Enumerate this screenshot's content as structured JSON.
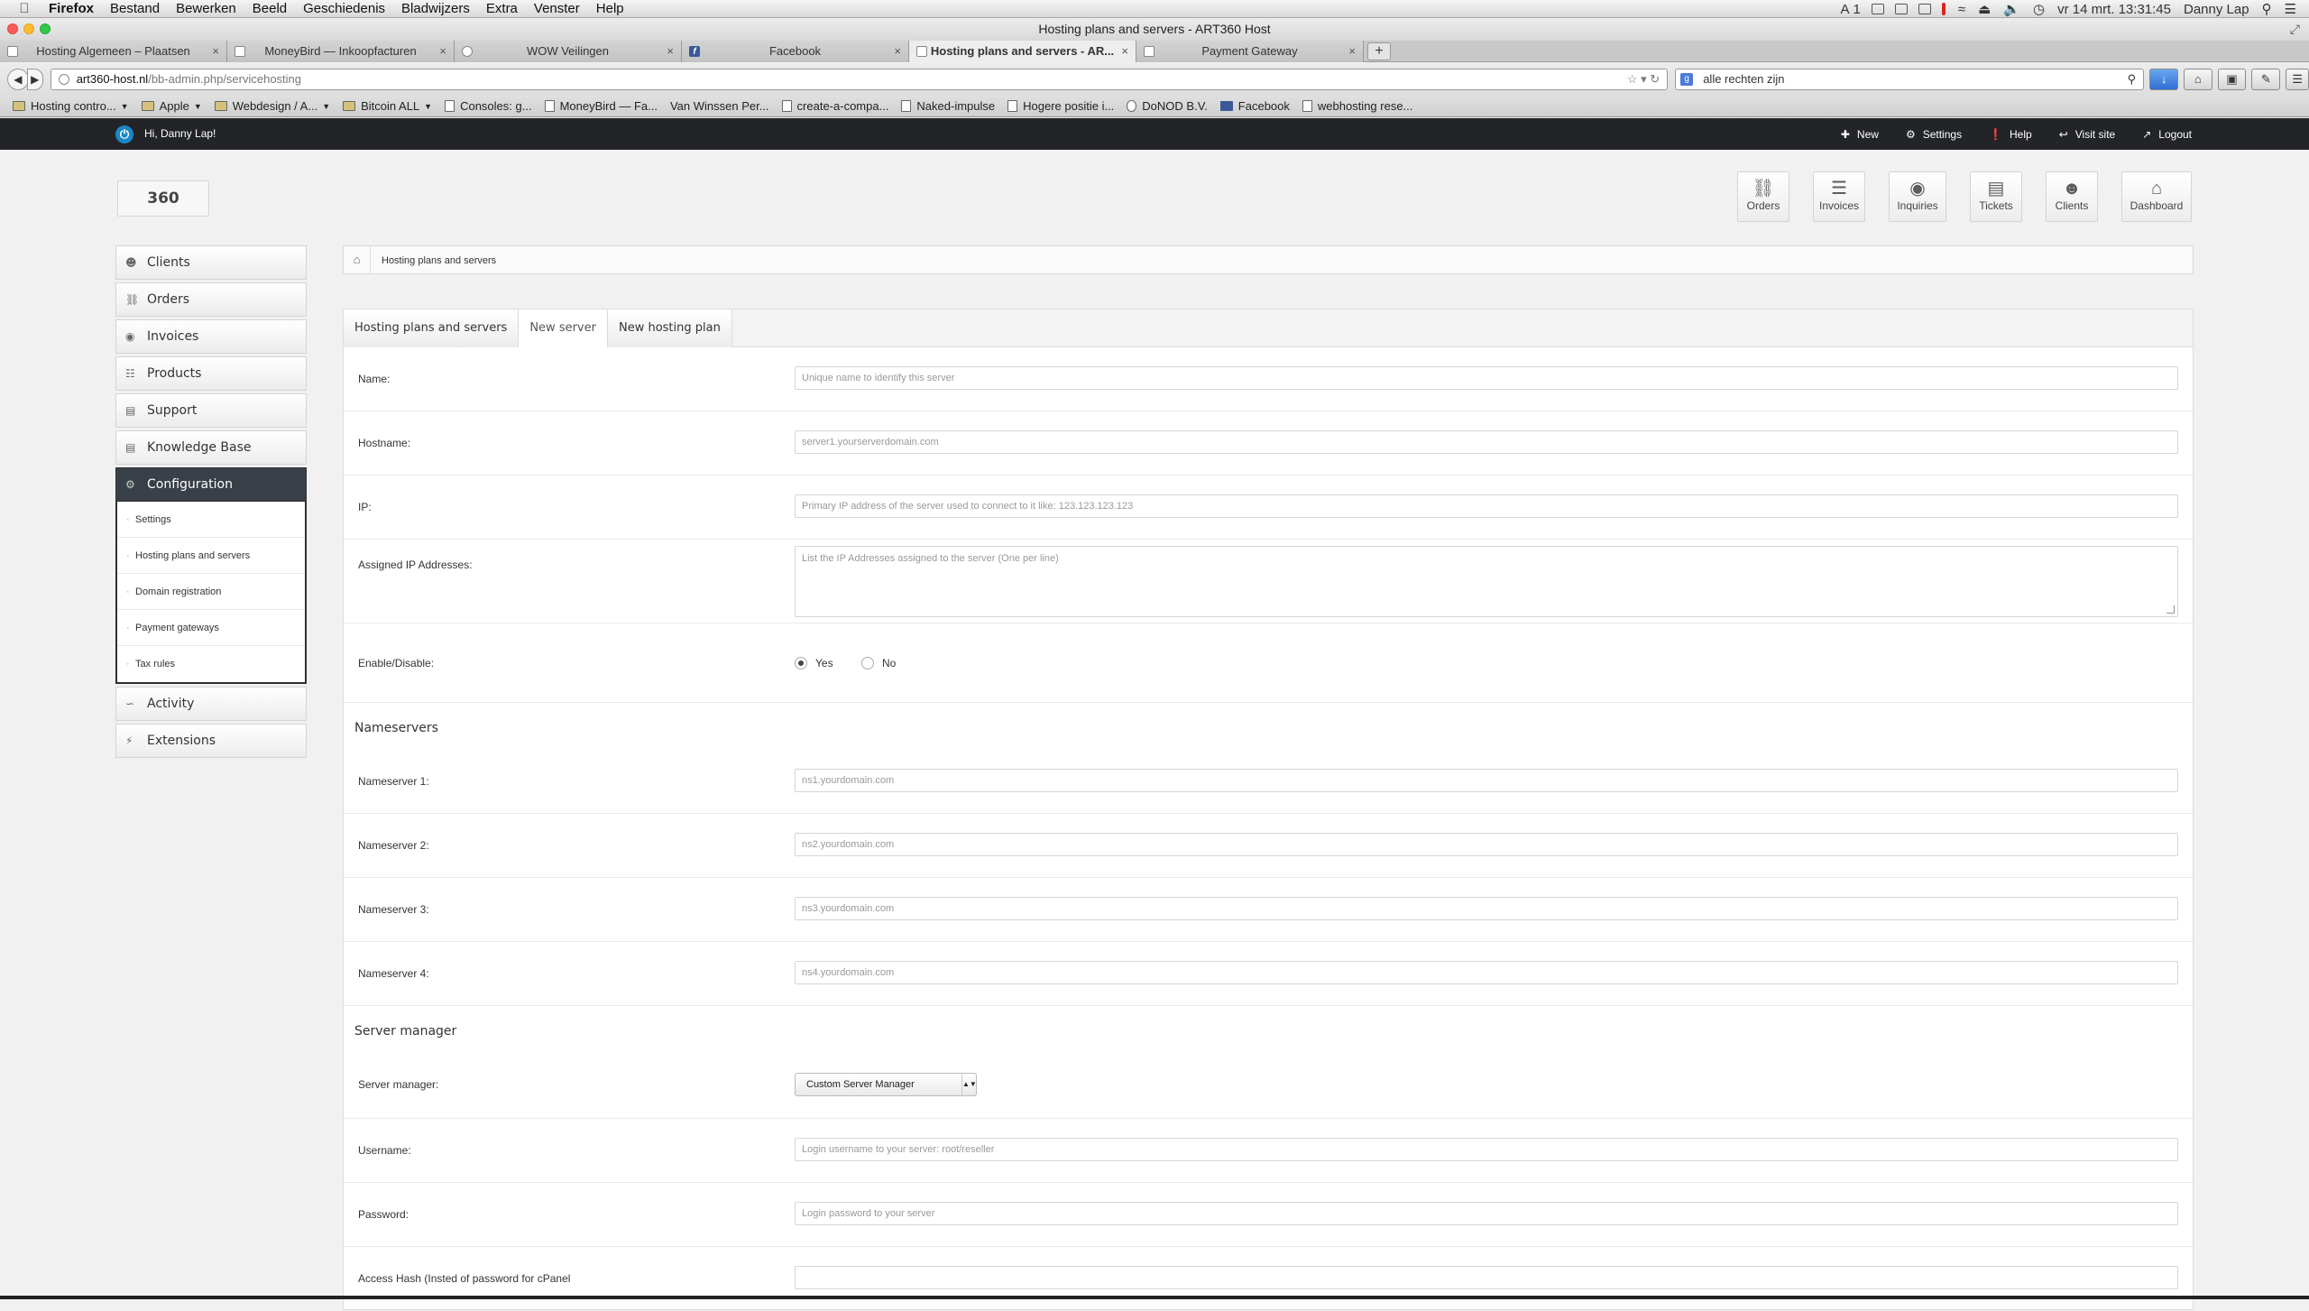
{
  "mac": {
    "menu": [
      "Firefox",
      "Bestand",
      "Bewerken",
      "Beeld",
      "Geschiedenis",
      "Bladwijzers",
      "Extra",
      "Venster",
      "Help"
    ],
    "status_badge": "1",
    "clock": "vr 14 mrt.  13:31:45",
    "user": "Danny Lap"
  },
  "window": {
    "title": "Hosting plans and servers - ART360 Host"
  },
  "tabs": [
    {
      "label": "Hosting Algemeen – Plaatsen"
    },
    {
      "label": "MoneyBird — Inkoopfacturen"
    },
    {
      "label": "WOW Veilingen"
    },
    {
      "label": "Facebook"
    },
    {
      "label": "Hosting plans and servers - AR..."
    },
    {
      "label": "Payment Gateway"
    }
  ],
  "url": {
    "host": "art360-host.nl",
    "path": "/bb-admin.php/servicehosting"
  },
  "search": {
    "value": "alle rechten zijn"
  },
  "bookmarks": [
    {
      "label": "Hosting contro..."
    },
    {
      "label": "Apple"
    },
    {
      "label": "Webdesign / A..."
    },
    {
      "label": "Bitcoin ALL"
    },
    {
      "label": "Consoles: g..."
    },
    {
      "label": "MoneyBird — Fa..."
    },
    {
      "label": "Van Winssen Per..."
    },
    {
      "label": "create-a-compa..."
    },
    {
      "label": "Naked-impulse"
    },
    {
      "label": "Hogere positie i..."
    },
    {
      "label": "DoNOD B.V."
    },
    {
      "label": "Facebook"
    },
    {
      "label": "webhosting rese..."
    }
  ],
  "admin": {
    "greeting": "Hi, Danny Lap!",
    "links": {
      "new": "New",
      "settings": "Settings",
      "help": "Help",
      "visit": "Visit site",
      "logout": "Logout"
    },
    "logo_text": "360"
  },
  "quick": [
    "Orders",
    "Invoices",
    "Inquiries",
    "Tickets",
    "Clients",
    "Dashboard"
  ],
  "sidebar": {
    "items": [
      "Clients",
      "Orders",
      "Invoices",
      "Products",
      "Support",
      "Knowledge Base",
      "Configuration"
    ],
    "submenu": [
      "Settings",
      "Hosting plans and servers",
      "Domain registration",
      "Payment gateways",
      "Tax rules"
    ],
    "after": [
      "Activity",
      "Extensions"
    ]
  },
  "breadcrumb": "Hosting plans and servers",
  "page_tabs": [
    "Hosting plans and servers",
    "New server",
    "New hosting plan"
  ],
  "form": {
    "name": {
      "label": "Name:",
      "placeholder": "Unique name to identify this server"
    },
    "hostname": {
      "label": "Hostname:",
      "placeholder": "server1.yourserverdomain.com"
    },
    "ip": {
      "label": "IP:",
      "placeholder": "Primary IP address of the server used to connect to it like: 123.123.123.123"
    },
    "assigned": {
      "label": "Assigned IP Addresses:",
      "placeholder": "List the IP Addresses assigned to the server (One per line)"
    },
    "enable": {
      "label": "Enable/Disable:",
      "yes": "Yes",
      "no": "No"
    },
    "ns_section": "Nameservers",
    "ns1": {
      "label": "Nameserver 1:",
      "placeholder": "ns1.yourdomain.com"
    },
    "ns2": {
      "label": "Nameserver 2:",
      "placeholder": "ns2.yourdomain.com"
    },
    "ns3": {
      "label": "Nameserver 3:",
      "placeholder": "ns3.yourdomain.com"
    },
    "ns4": {
      "label": "Nameserver 4:",
      "placeholder": "ns4.yourdomain.com"
    },
    "sm_section": "Server manager",
    "manager": {
      "label": "Server manager:",
      "value": "Custom Server Manager"
    },
    "username": {
      "label": "Username:",
      "placeholder": "Login username to your server: root/reseller"
    },
    "password": {
      "label": "Password:",
      "placeholder": "Login password to your server"
    },
    "access": {
      "label": "Access Hash (Insted of password for cPanel"
    }
  }
}
